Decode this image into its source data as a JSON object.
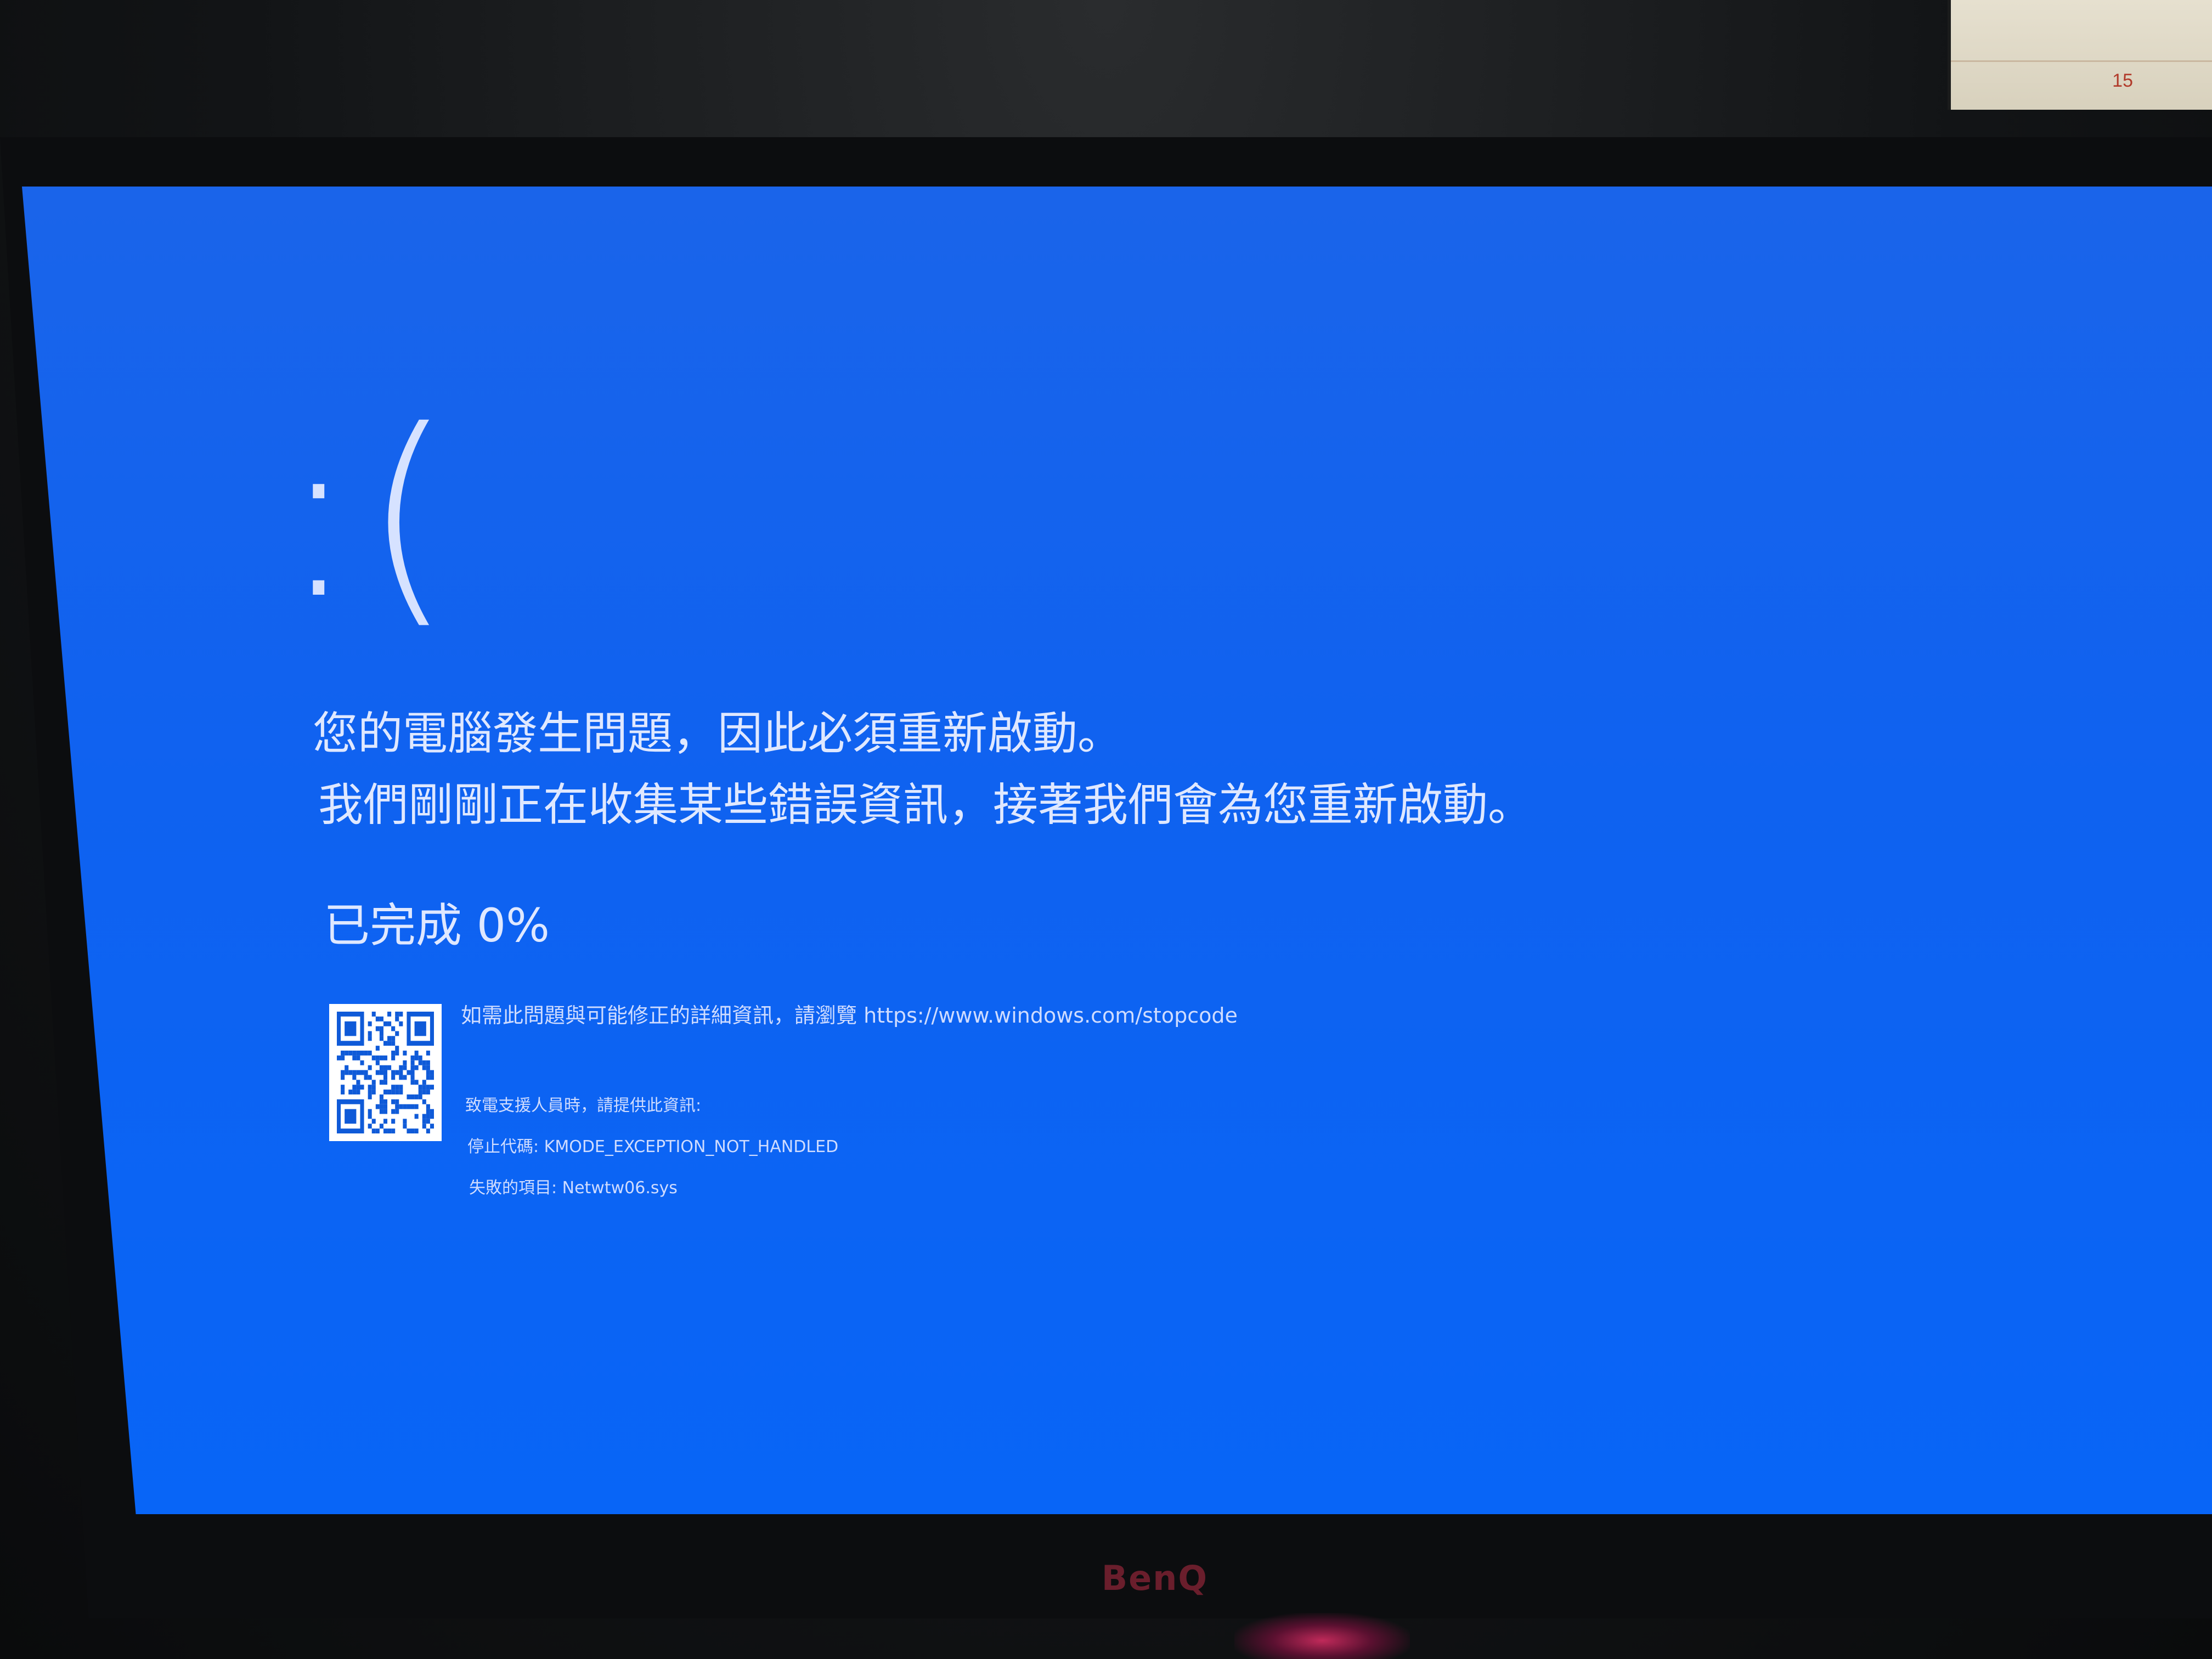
{
  "calendar": {
    "day": "15"
  },
  "monitor": {
    "brand": "BenQ"
  },
  "bsod": {
    "face": ":(",
    "line1": "您的電腦發生問題，因此必須重新啟動。",
    "line2": "我們剛剛正在收集某些錯誤資訊，接著我們會為您重新啟動。",
    "progress_label": "已完成 0%",
    "progress_percent": 0,
    "more_info": "如需此問題與可能修正的詳細資訊，請瀏覽 https://www.windows.com/stopcode",
    "support_note": "致電支援人員時，請提供此資訊:",
    "stop_code": "停止代碼: KMODE_EXCEPTION_NOT_HANDLED",
    "failed_item": "失敗的項目: Netwtw06.sys"
  },
  "colors": {
    "bsod_blue": "#0f62f0",
    "text": "#dfe8ff"
  },
  "icons": {
    "qr": "qr-code-icon"
  }
}
